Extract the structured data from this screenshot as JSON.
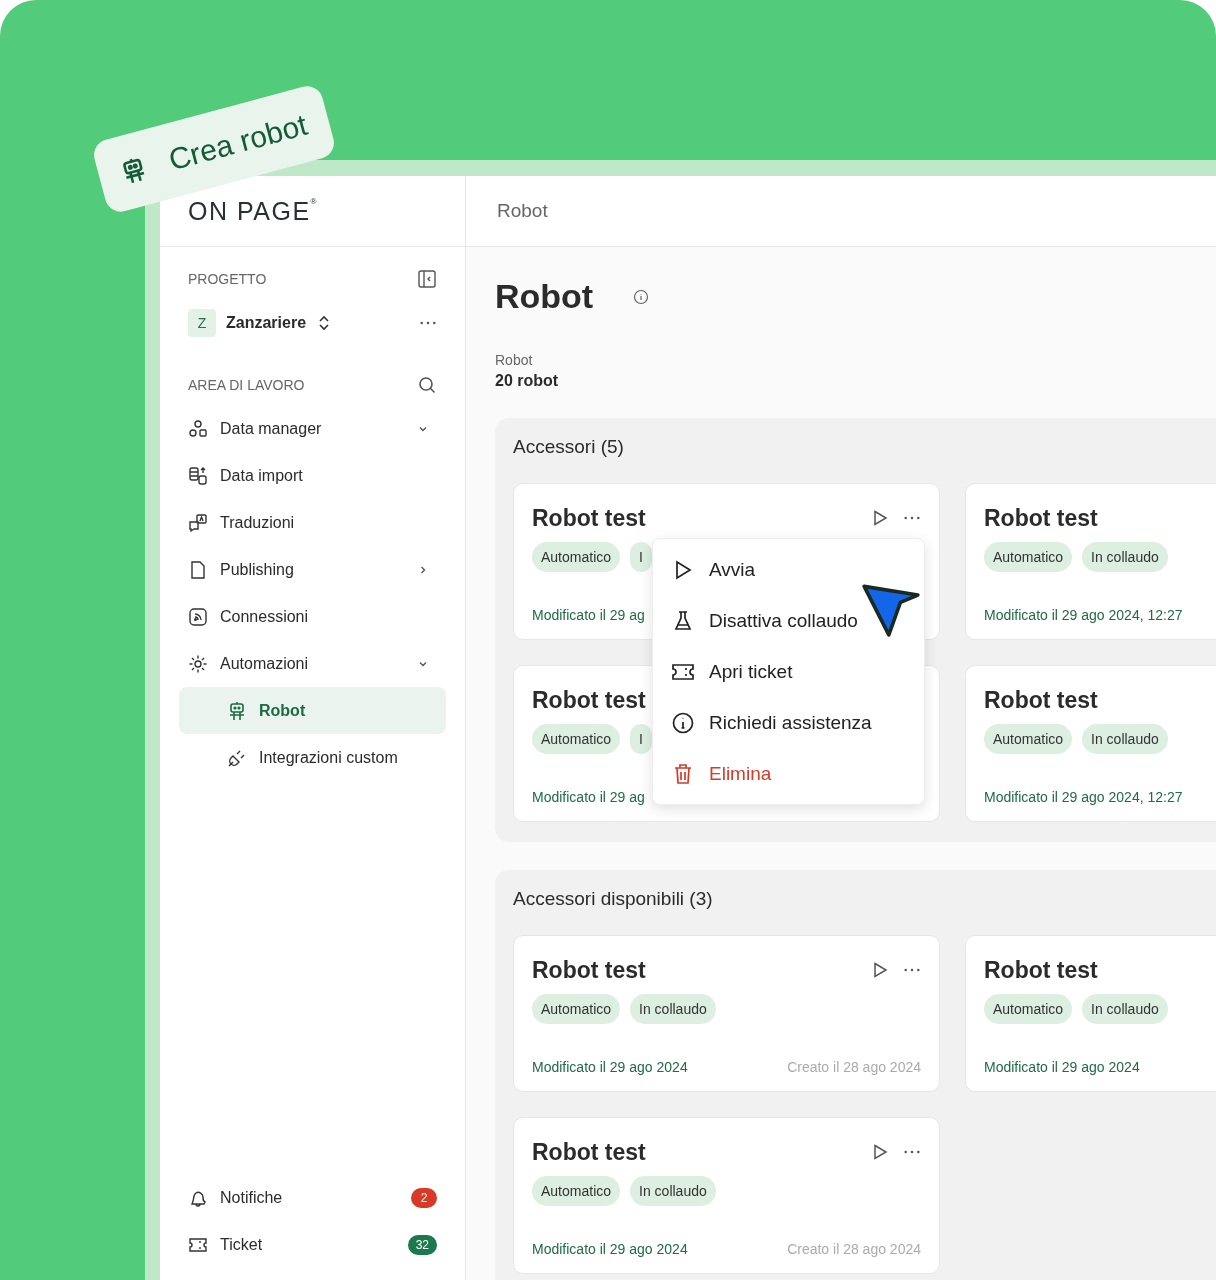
{
  "badge": {
    "label": "Crea robot"
  },
  "logo": {
    "text": "ON PAGE",
    "mark": "®"
  },
  "sidebar": {
    "project_heading": "PROGETTO",
    "project": {
      "initial": "Z",
      "name": "Zanzariere"
    },
    "workspace_heading": "AREA DI LAVORO",
    "items": [
      {
        "label": "Data manager",
        "expanded": true
      },
      {
        "label": "Data import"
      },
      {
        "label": "Traduzioni"
      },
      {
        "label": "Publishing",
        "expanded": false
      },
      {
        "label": "Connessioni"
      },
      {
        "label": "Automazioni",
        "expanded": true,
        "children": [
          {
            "label": "Robot",
            "selected": true
          },
          {
            "label": "Integrazioni custom",
            "selected": false
          }
        ]
      }
    ],
    "footer_items": [
      {
        "label": "Notifiche",
        "count": "2",
        "color": "#d93a26"
      },
      {
        "label": "Ticket",
        "count": "32",
        "color": "#1b7a4d"
      }
    ]
  },
  "breadcrumb": "Robot",
  "page_title": "Robot",
  "summary": {
    "label": "Robot",
    "value": "20 robot"
  },
  "sections": [
    {
      "title": "Accessori (5)",
      "cards": [
        {
          "title": "Robot test",
          "tags": [
            "Automatico",
            "I"
          ],
          "modified": "Modificato il 29 ag",
          "actions": true,
          "menu_open": true
        },
        {
          "title": "Robot test",
          "tags": [
            "Automatico",
            "In collaudo"
          ],
          "modified": "Modificato il 29 ago 2024, 12:27"
        },
        {
          "title": "Robot test",
          "tags": [
            "Automatico",
            "I"
          ],
          "modified": "Modificato il 29 ag"
        },
        {
          "title": "Robot test",
          "tags": [
            "Automatico",
            "In collaudo"
          ],
          "modified": "Modificato il 29 ago 2024, 12:27"
        }
      ]
    },
    {
      "title": "Accessori disponibili (3)",
      "cards": [
        {
          "title": "Robot test",
          "tags": [
            "Automatico",
            "In collaudo"
          ],
          "modified": "Modificato il 29 ago 2024",
          "created": "Creato il 28 ago 2024",
          "actions": true
        },
        {
          "title": "Robot test",
          "tags": [
            "Automatico",
            "In collaudo"
          ],
          "modified": "Modificato il 29 ago 2024"
        },
        {
          "title": "Robot test",
          "tags": [
            "Automatico",
            "In collaudo"
          ],
          "modified": "Modificato il 29 ago 2024",
          "created": "Creato il 28 ago 2024",
          "actions": true
        }
      ]
    }
  ],
  "context_menu": {
    "items": [
      {
        "label": "Avvia",
        "kind": "normal"
      },
      {
        "label": "Disattiva collaudo",
        "kind": "normal"
      },
      {
        "label": "Apri ticket",
        "kind": "normal"
      },
      {
        "label": "Richiedi assistenza",
        "kind": "normal"
      },
      {
        "label": "Elimina",
        "kind": "danger"
      }
    ]
  }
}
